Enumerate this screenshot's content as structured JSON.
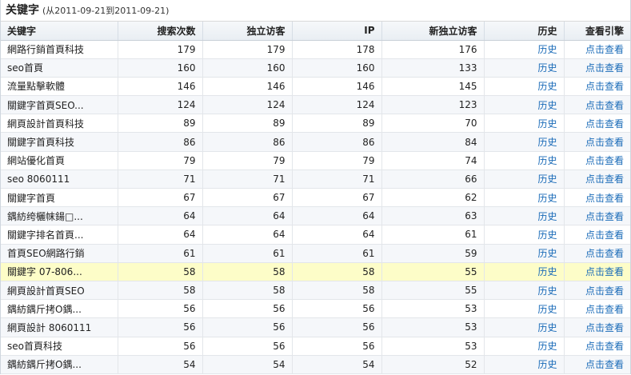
{
  "title": "关键字",
  "date_range": "(从2011-09-21到2011-09-21)",
  "columns": [
    "关键字",
    "搜索次数",
    "独立访客",
    "IP",
    "新独立访客",
    "历史",
    "查看引擎"
  ],
  "link_labels": {
    "history": "历史",
    "view": "点击查看"
  },
  "rows": [
    {
      "keyword": "網路行銷首頁科技",
      "searches": "179",
      "visitors": "179",
      "ip": "178",
      "new_visitors": "176",
      "history": "历史",
      "view": "点击查看"
    },
    {
      "keyword": "seo首頁",
      "searches": "160",
      "visitors": "160",
      "ip": "160",
      "new_visitors": "133",
      "history": "历史",
      "view": "点击查看"
    },
    {
      "keyword": "流量點擊軟體",
      "searches": "146",
      "visitors": "146",
      "ip": "146",
      "new_visitors": "145",
      "history": "历史",
      "view": "点击查看"
    },
    {
      "keyword": "關鍵字首頁SEO...",
      "searches": "124",
      "visitors": "124",
      "ip": "124",
      "new_visitors": "123",
      "history": "历史",
      "view": "点击查看"
    },
    {
      "keyword": "網頁設計首頁科技",
      "searches": "89",
      "visitors": "89",
      "ip": "89",
      "new_visitors": "70",
      "history": "历史",
      "view": "点击查看"
    },
    {
      "keyword": "關鍵字首頁科技",
      "searches": "86",
      "visitors": "86",
      "ip": "86",
      "new_visitors": "84",
      "history": "历史",
      "view": "点击查看"
    },
    {
      "keyword": "網站優化首頁",
      "searches": "79",
      "visitors": "79",
      "ip": "79",
      "new_visitors": "74",
      "history": "历史",
      "view": "点击查看"
    },
    {
      "keyword": "seo 8060111",
      "searches": "71",
      "visitors": "71",
      "ip": "71",
      "new_visitors": "66",
      "history": "历史",
      "view": "点击查看"
    },
    {
      "keyword": "關鍵字首頁",
      "searches": "67",
      "visitors": "67",
      "ip": "67",
      "new_visitors": "62",
      "history": "历史",
      "view": "点击查看"
    },
    {
      "keyword": "鍝紡绔欐帓鍚□...",
      "searches": "64",
      "visitors": "64",
      "ip": "64",
      "new_visitors": "63",
      "history": "历史",
      "view": "点击查看"
    },
    {
      "keyword": "關鍵字排名首頁...",
      "searches": "64",
      "visitors": "64",
      "ip": "64",
      "new_visitors": "61",
      "history": "历史",
      "view": "点击查看"
    },
    {
      "keyword": "首頁SEO網路行銷",
      "searches": "61",
      "visitors": "61",
      "ip": "61",
      "new_visitors": "59",
      "history": "历史",
      "view": "点击查看"
    },
    {
      "keyword": "關鍵字 07-806...",
      "searches": "58",
      "visitors": "58",
      "ip": "58",
      "new_visitors": "55",
      "history": "历史",
      "view": "点击查看",
      "highlight": true
    },
    {
      "keyword": "網頁設計首頁SEO",
      "searches": "58",
      "visitors": "58",
      "ip": "58",
      "new_visitors": "55",
      "history": "历史",
      "view": "点击查看"
    },
    {
      "keyword": "鍝紡鍝斤拷O鍝...",
      "searches": "56",
      "visitors": "56",
      "ip": "56",
      "new_visitors": "53",
      "history": "历史",
      "view": "点击查看"
    },
    {
      "keyword": "網頁設計 8060111",
      "searches": "56",
      "visitors": "56",
      "ip": "56",
      "new_visitors": "53",
      "history": "历史",
      "view": "点击查看"
    },
    {
      "keyword": "seo首頁科技",
      "searches": "56",
      "visitors": "56",
      "ip": "56",
      "new_visitors": "53",
      "history": "历史",
      "view": "点击查看"
    },
    {
      "keyword": "鍝紡鍝斤拷O鍝...",
      "searches": "54",
      "visitors": "54",
      "ip": "54",
      "new_visitors": "52",
      "history": "历史",
      "view": "点击查看"
    }
  ]
}
